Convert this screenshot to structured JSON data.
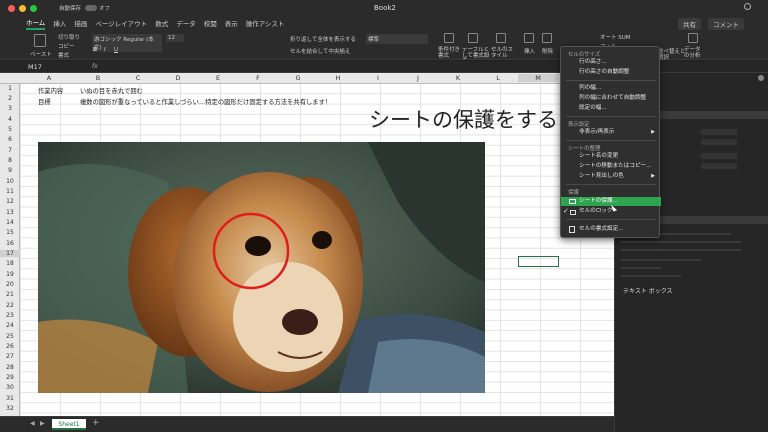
{
  "titlebar": {
    "autosave": "自動保存",
    "toggle": "オフ",
    "doc_title": "Book2"
  },
  "ribbon_tabs": [
    "ホーム",
    "挿入",
    "描画",
    "ページレイアウト",
    "数式",
    "データ",
    "校閲",
    "表示"
  ],
  "ribbon_tell_me": "操作アシスト",
  "share_label": "共有",
  "comment_label": "コメント",
  "ribbon": {
    "paste": "ペースト",
    "cut": "切り取り",
    "copy": "コピー",
    "format": "書式",
    "font_name": "游ゴシック Regular (本文)",
    "font_size": "12",
    "wrap": "折り返して全体を表示する",
    "merge": "セルを結合して中央揃え",
    "numfmt": "標準",
    "cond": "条件付き書式",
    "table": "テーブルとして書式設定",
    "styles": "セルのスタイル",
    "insert": "挿入",
    "delete": "削除",
    "autosum": "オート SUM",
    "fill": "フィル",
    "sort": "並べ替えと",
    "select": "選択",
    "analyze": "データの分析"
  },
  "namebox": "M17",
  "fx": "fx",
  "columns": [
    "A",
    "B",
    "C",
    "D",
    "E",
    "F",
    "G",
    "H",
    "I",
    "J",
    "K",
    "L",
    "M"
  ],
  "rows": [
    "1",
    "2",
    "3",
    "4",
    "5",
    "6",
    "7",
    "8",
    "9",
    "10",
    "11",
    "12",
    "13",
    "14",
    "15",
    "16",
    "17",
    "18",
    "19",
    "20",
    "21",
    "22",
    "23",
    "24",
    "25",
    "26",
    "27",
    "28",
    "29",
    "30",
    "31",
    "32"
  ],
  "cells": {
    "a1": "作業内容",
    "b1": "いぬの目を赤丸で囲む",
    "a2": "目標",
    "b2": "複数の図形が重なっていると作業しづらい…特定の図形だけ固定する方法を共有します！"
  },
  "overlay_text": "シートの保護をすると",
  "sheet_tab": "Sheet1",
  "menu": {
    "section_cell_size": "セルのサイズ",
    "row_height": "行の高さ...",
    "autofit_row": "行の高さの自動調整",
    "col_width": "列の幅...",
    "autofit_col": "列の幅に合わせて自動調整",
    "default_width": "既定の幅...",
    "section_visibility": "表示設定",
    "hide_unhide": "非表示/再表示",
    "section_organize": "シートの整理",
    "rename": "シート名の変更",
    "move_copy": "シートの移動またはコピー...",
    "tab_color": "シート見出しの色",
    "section_protect": "保護",
    "protect_sheet": "シートの保護...",
    "lock_cell": "セルのロック",
    "format_cells": "セルの書式設定..."
  },
  "panel": {
    "textbox": "テキスト ボックス"
  },
  "colors": {
    "accent": "#217346",
    "highlight": "#2ea44f",
    "circle": "#e21b1b"
  }
}
